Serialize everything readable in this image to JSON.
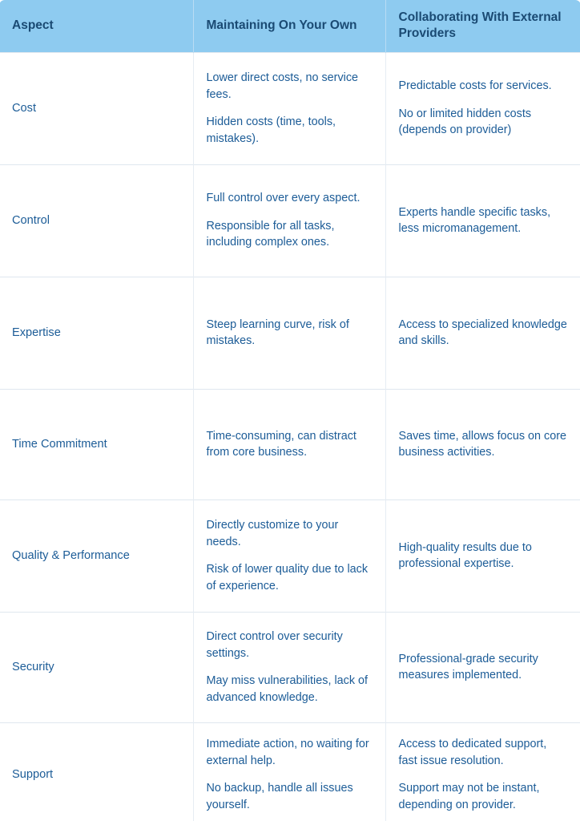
{
  "table": {
    "columns": [
      {
        "key": "aspect",
        "label": "Aspect"
      },
      {
        "key": "own",
        "label": "Maintaining On Your Own"
      },
      {
        "key": "partner",
        "label": "Collaborating With External Providers"
      }
    ],
    "rows": [
      {
        "aspect": "Cost",
        "own": [
          "Lower direct costs, no service fees.",
          "Hidden costs (time, tools, mistakes)."
        ],
        "partner": [
          "Predictable costs for services.",
          "No or limited hidden costs (depends on provider)"
        ]
      },
      {
        "aspect": "Control",
        "own": [
          "Full control over every aspect.",
          "Responsible for all tasks, including complex ones."
        ],
        "partner": [
          "Experts handle specific tasks, less micromanagement."
        ]
      },
      {
        "aspect": "Expertise",
        "own": [
          "Steep learning curve, risk of mistakes."
        ],
        "partner": [
          "Access to specialized knowledge and skills."
        ]
      },
      {
        "aspect": "Time Commitment",
        "own": [
          "Time-consuming, can distract from core business."
        ],
        "partner": [
          "Saves time, allows focus on core business activities."
        ]
      },
      {
        "aspect": "Quality & Performance",
        "own": [
          "Directly customize to your needs.",
          "Risk of lower quality due to lack of experience."
        ],
        "partner": [
          "High-quality results due to professional expertise."
        ]
      },
      {
        "aspect": "Security",
        "own": [
          "Direct control over security settings.",
          "May miss vulnerabilities, lack of advanced knowledge."
        ],
        "partner": [
          "Professional-grade security measures implemented."
        ]
      },
      {
        "aspect": "Support",
        "own": [
          "Immediate action, no waiting for external help.",
          "No backup, handle all issues yourself."
        ],
        "partner": [
          "Access to dedicated support, fast issue resolution.",
          "Support may not be instant, depending on provider."
        ]
      }
    ]
  },
  "colors": {
    "header_bg": "#8ecbf0",
    "header_text": "#1a4a73",
    "body_text": "#1c5c97",
    "border": "#dfe7ef",
    "page_bg": "#ffffff"
  }
}
